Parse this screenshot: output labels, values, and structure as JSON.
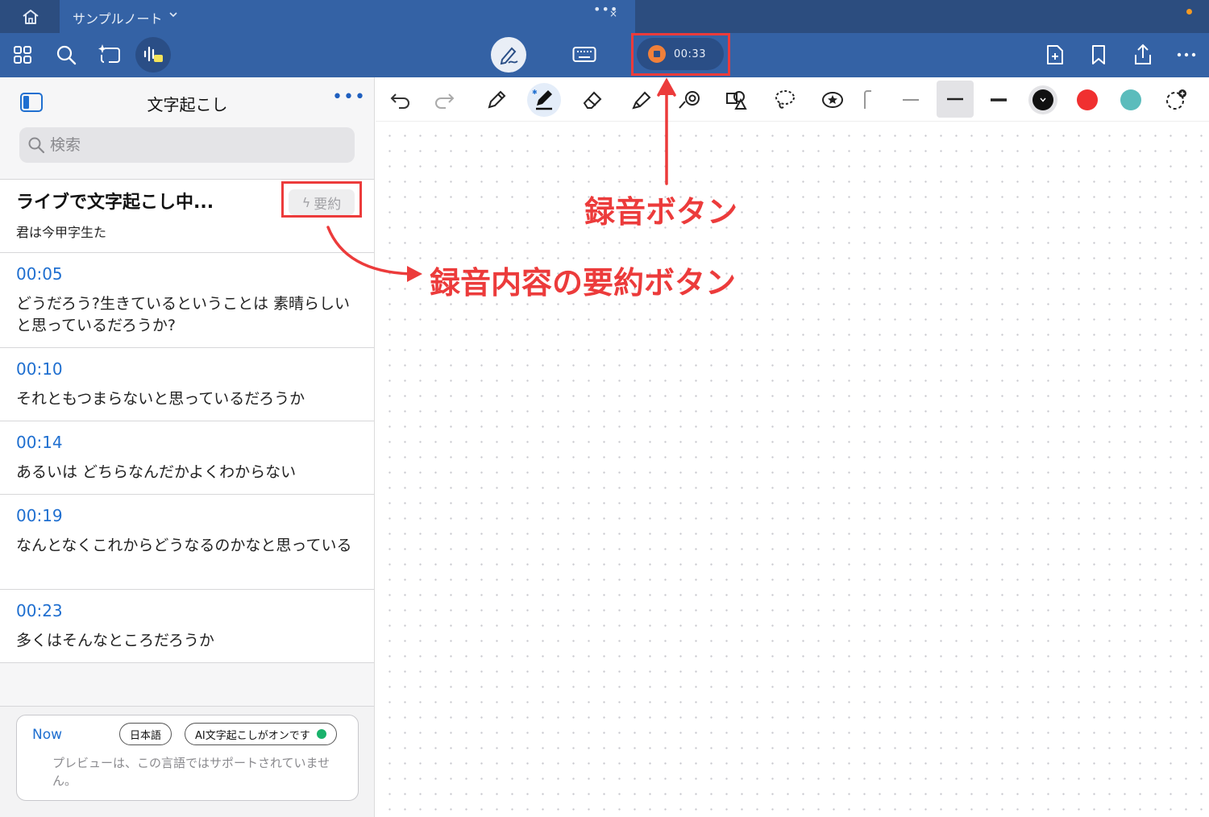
{
  "tab": {
    "title": "サンプルノート",
    "dots": "•••",
    "close": "×"
  },
  "recording": {
    "time": "00:33"
  },
  "sidebar": {
    "title": "文字起こし",
    "more": "•••",
    "search_placeholder": "検索",
    "live": {
      "title": "ライブで文字起こし中...",
      "preview": "君は今甲字生た",
      "summary_label": "要約"
    },
    "entries": [
      {
        "time": "00:05",
        "text": "どうだろう?生きているということは 素晴らしいと思っているだろうか?"
      },
      {
        "time": "00:10",
        "text": "それともつまらないと思っているだろうか"
      },
      {
        "time": "00:14",
        "text": "あるいは どちらなんだかよくわからない"
      },
      {
        "time": "00:19",
        "text": "なんとなくこれからどうなるのかなと思っている"
      },
      {
        "time": "00:23",
        "text": "多くはそんなところだろうか"
      }
    ],
    "now": {
      "label": "Now",
      "language": "日本語",
      "ai_status": "AI文字起こしがオンです",
      "note": "プレビューは、この言語ではサポートされていません。"
    }
  },
  "colors": {
    "titlebar": "#2c4d7f",
    "toolbar": "#3462a5",
    "accent": "#1f6fd0",
    "record": "#f0803a",
    "annotation": "#ec3b3b",
    "swatch_black": "#111111",
    "swatch_red": "#f03030",
    "swatch_teal": "#5bbcbc"
  },
  "annotations": {
    "record_label": "録音ボタン",
    "summary_label": "録音内容の要約ボタン"
  }
}
